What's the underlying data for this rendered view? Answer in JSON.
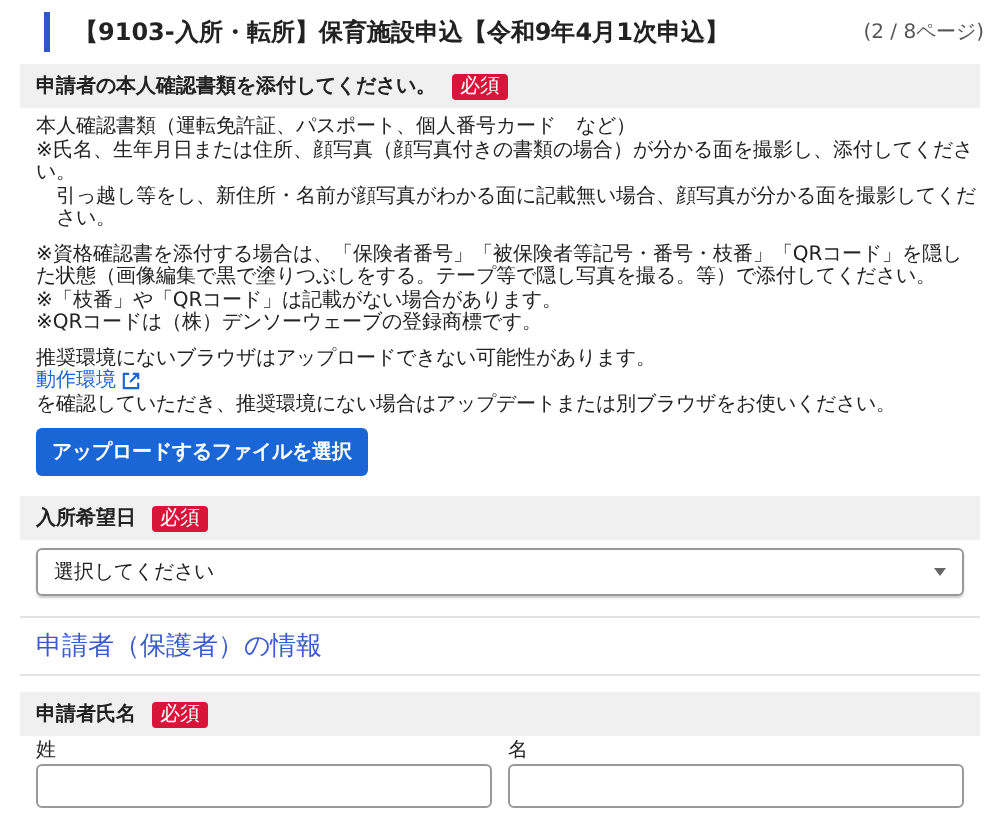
{
  "title": "【9103-入所・転所】保育施設申込【令和9年4月1次申込】",
  "page_indicator": "(2 / 8ページ)",
  "id_documents": {
    "label": "申請者の本人確認書類を添付してください。",
    "required": true,
    "badge": "必須",
    "groups": [
      [
        {
          "kind": "text",
          "text": "本人確認書類（運転免許証、パスポート、個人番号カード　など）"
        },
        {
          "kind": "text",
          "text": "※氏名、生年月日または住所、顔写真（顔写真付きの書類の場合）が分かる面を撮影し、添付してください。"
        },
        {
          "kind": "indent",
          "text": "引っ越し等をし、新住所・名前が顔写真がわかる面に記載無い場合、顔写真が分かる面を撮影してください。"
        }
      ],
      [
        {
          "kind": "text",
          "text": "※資格確認書を添付する場合は、「保険者番号」「被保険者等記号・番号・枝番」「QRコード」を隠した状態（画像編集で黒で塗りつぶしをする。テープ等で隠し写真を撮る。等）で添付してください。"
        },
        {
          "kind": "text",
          "text": "※「枝番」や「QRコード」は記載がない場合があります。"
        },
        {
          "kind": "text",
          "text": "※QRコードは（株）デンソーウェーブの登録商標です。"
        }
      ],
      [
        {
          "kind": "text",
          "text": "推奨環境にないブラウザはアップロードできない可能性があります。"
        },
        {
          "kind": "link",
          "text": "動作環境"
        },
        {
          "kind": "text",
          "text": "を確認していただき、推奨環境にない場合はアップデートまたは別ブラウザをお使いください。"
        }
      ]
    ],
    "upload_button": "アップロードするファイルを選択"
  },
  "entry_date": {
    "label": "入所希望日",
    "required": true,
    "badge": "必須",
    "select_value": "選択してください"
  },
  "section_heading": "申請者（保護者）の情報",
  "applicant_name": {
    "label": "申請者氏名",
    "required": true,
    "badge": "必須",
    "fields": [
      {
        "label": "姓"
      },
      {
        "label": "名"
      }
    ]
  }
}
